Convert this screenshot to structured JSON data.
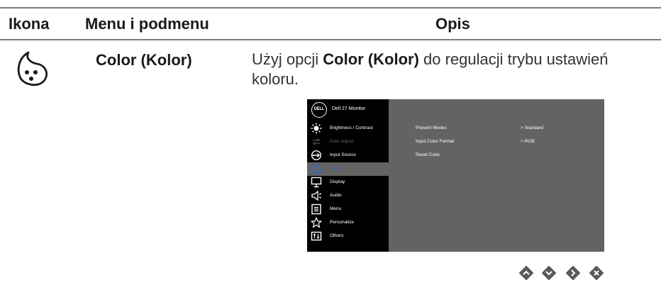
{
  "table": {
    "header": {
      "icon": "Ikona",
      "menu": "Menu i podmenu",
      "desc": "Opis"
    },
    "row": {
      "icon": "color-palette-icon",
      "submenu": "Color (Kolor)",
      "desc_pre": "Użyj opcji ",
      "desc_bold": "Color (Kolor)",
      "desc_post": " do regulacji trybu ustawień koloru."
    }
  },
  "osd": {
    "logo": "DELL",
    "model": "Dell 27 Monitor",
    "menu_items": [
      {
        "label": "Brightness / Contrast",
        "icon": "brightness-icon",
        "state": "normal"
      },
      {
        "label": "Auto Adjust",
        "icon": "auto-adjust-icon",
        "state": "dim"
      },
      {
        "label": "Input Source",
        "icon": "input-source-icon",
        "state": "normal"
      },
      {
        "label": "Color",
        "icon": "color-icon",
        "state": "active"
      },
      {
        "label": "Display",
        "icon": "display-icon",
        "state": "normal"
      },
      {
        "label": "Audio",
        "icon": "audio-icon",
        "state": "normal"
      },
      {
        "label": "Menu",
        "icon": "menu-icon",
        "state": "normal"
      },
      {
        "label": "Personalize",
        "icon": "star-icon",
        "state": "normal"
      },
      {
        "label": "Others",
        "icon": "others-icon",
        "state": "normal"
      }
    ],
    "submenu": [
      {
        "label": "Present Modes",
        "value": ">  Standard"
      },
      {
        "label": "Input Color Format",
        "value": ">  RGB"
      },
      {
        "label": "Reset Color",
        "value": ""
      }
    ],
    "colors": {
      "panel": "#000000",
      "content": "#636363",
      "active_text": "#2f6fd0",
      "nav_button": "#5a5a5a"
    }
  },
  "nav_buttons": [
    "up-button-icon",
    "down-button-icon",
    "right-button-icon",
    "close-button-icon"
  ]
}
